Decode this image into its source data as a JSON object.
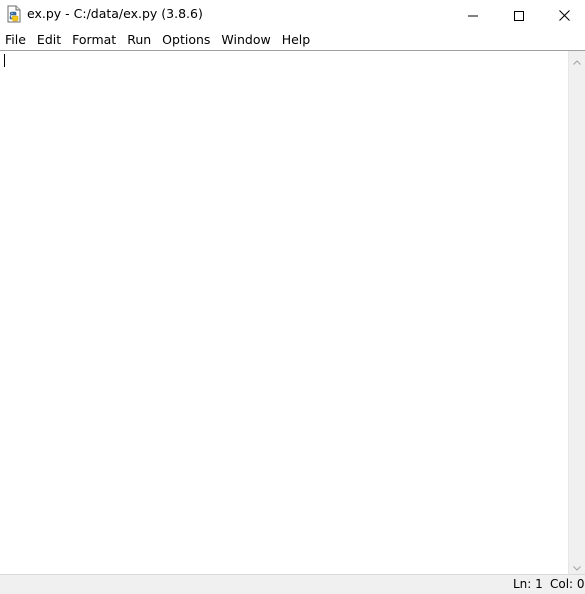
{
  "window": {
    "title": "ex.py - C:/data/ex.py (3.8.6)",
    "icon": "python-file-icon",
    "controls": {
      "minimize_icon": "minimize-icon",
      "maximize_icon": "maximize-icon",
      "close_icon": "close-icon"
    }
  },
  "menubar": {
    "items": [
      {
        "label": "File"
      },
      {
        "label": "Edit"
      },
      {
        "label": "Format"
      },
      {
        "label": "Run"
      },
      {
        "label": "Options"
      },
      {
        "label": "Window"
      },
      {
        "label": "Help"
      }
    ]
  },
  "editor": {
    "content": ""
  },
  "statusbar": {
    "ln": "Ln: 1",
    "col": "Col: 0"
  },
  "colors": {
    "background": "#ffffff",
    "statusbar_bg": "#f0f0f0",
    "scrollbar_bg": "#f0f0f0",
    "text": "#000000"
  }
}
